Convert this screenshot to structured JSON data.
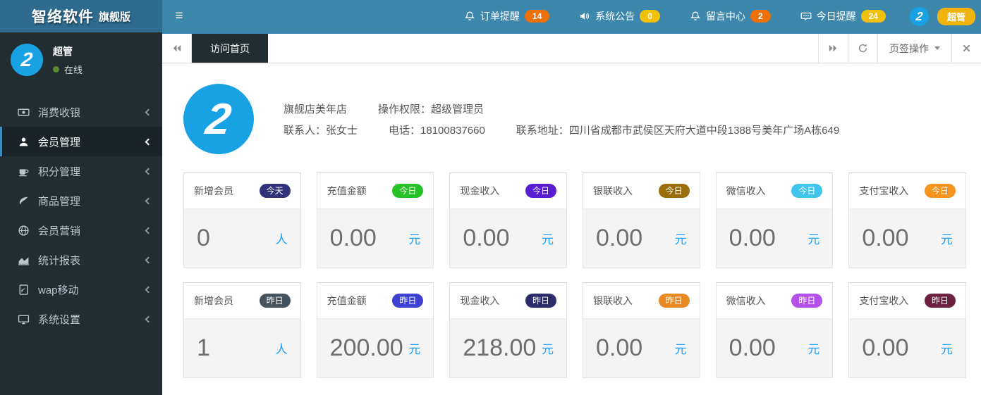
{
  "header": {
    "brand_title": "智络软件",
    "brand_suffix": "旗舰版",
    "menu_toggle_icon": "≡",
    "notifications": [
      {
        "name": "order-reminder",
        "icon": "bell",
        "label": "订单提醒",
        "count": "14",
        "badge_color": "#ee7008"
      },
      {
        "name": "system-announcement",
        "icon": "speaker",
        "label": "系统公告",
        "count": "0",
        "badge_color": "#f2c10e"
      },
      {
        "name": "message-center",
        "icon": "bell",
        "label": "留言中心",
        "count": "2",
        "badge_color": "#ee7008"
      },
      {
        "name": "today-reminder",
        "icon": "comment",
        "label": "今日提醒",
        "count": "24",
        "badge_color": "#f2c10e"
      }
    ],
    "avatar_glyph": "2",
    "user_role_badge": "超管"
  },
  "sidebar": {
    "user_name": "超管",
    "user_status": "在线",
    "status_color": "#568a35",
    "avatar_glyph": "2",
    "menu": [
      {
        "name": "consume-cashier",
        "icon": "money",
        "label": "消费收银"
      },
      {
        "name": "member-manage",
        "icon": "user",
        "label": "会员管理",
        "active": true
      },
      {
        "name": "points-manage",
        "icon": "cup",
        "label": "积分管理"
      },
      {
        "name": "goods-manage",
        "icon": "leaf",
        "label": "商品管理"
      },
      {
        "name": "member-marketing",
        "icon": "globe",
        "label": "会员营销"
      },
      {
        "name": "stats-report",
        "icon": "chart",
        "label": "统计报表"
      },
      {
        "name": "wap-mobile",
        "icon": "mobile",
        "label": "wap移动"
      },
      {
        "name": "system-settings",
        "icon": "desktop",
        "label": "系统设置"
      }
    ]
  },
  "tabbar": {
    "active_tab": "访问首页",
    "ops_label": "页签操作"
  },
  "store": {
    "avatar_glyph": "2",
    "name": "旗舰店美年店",
    "permission": "操作权限：超级管理员",
    "contact": "联系人：张女士",
    "phone": "电话：18100837660",
    "address": "联系地址：四川省成都市武侯区天府大道中段1388号美年广场A栋649"
  },
  "stats": {
    "today": [
      {
        "label": "新增会员",
        "badge": "今天",
        "badge_color": "#32327a",
        "value": "0",
        "unit": "人"
      },
      {
        "label": "充值金额",
        "badge": "今日",
        "badge_color": "#25c225",
        "value": "0.00",
        "unit": "元"
      },
      {
        "label": "现金收入",
        "badge": "今日",
        "badge_color": "#5a1ed2",
        "value": "0.00",
        "unit": "元"
      },
      {
        "label": "银联收入",
        "badge": "今日",
        "badge_color": "#9a6e0a",
        "value": "0.00",
        "unit": "元"
      },
      {
        "label": "微信收入",
        "badge": "今日",
        "badge_color": "#41c5ef",
        "value": "0.00",
        "unit": "元"
      },
      {
        "label": "支付宝收入",
        "badge": "今日",
        "badge_color": "#f6941e",
        "value": "0.00",
        "unit": "元"
      }
    ],
    "yesterday": [
      {
        "label": "新增会员",
        "badge": "昨日",
        "badge_color": "#46535d",
        "value": "1",
        "unit": "人"
      },
      {
        "label": "充值金额",
        "badge": "昨日",
        "badge_color": "#3c41d4",
        "value": "200.00",
        "unit": "元"
      },
      {
        "label": "现金收入",
        "badge": "昨日",
        "badge_color": "#2c2c6b",
        "value": "218.00",
        "unit": "元"
      },
      {
        "label": "银联收入",
        "badge": "昨日",
        "badge_color": "#e78a25",
        "value": "0.00",
        "unit": "元"
      },
      {
        "label": "微信收入",
        "badge": "昨日",
        "badge_color": "#b250e8",
        "value": "0.00",
        "unit": "元"
      },
      {
        "label": "支付宝收入",
        "badge": "昨日",
        "badge_color": "#6d2140",
        "value": "0.00",
        "unit": "元"
      }
    ]
  }
}
